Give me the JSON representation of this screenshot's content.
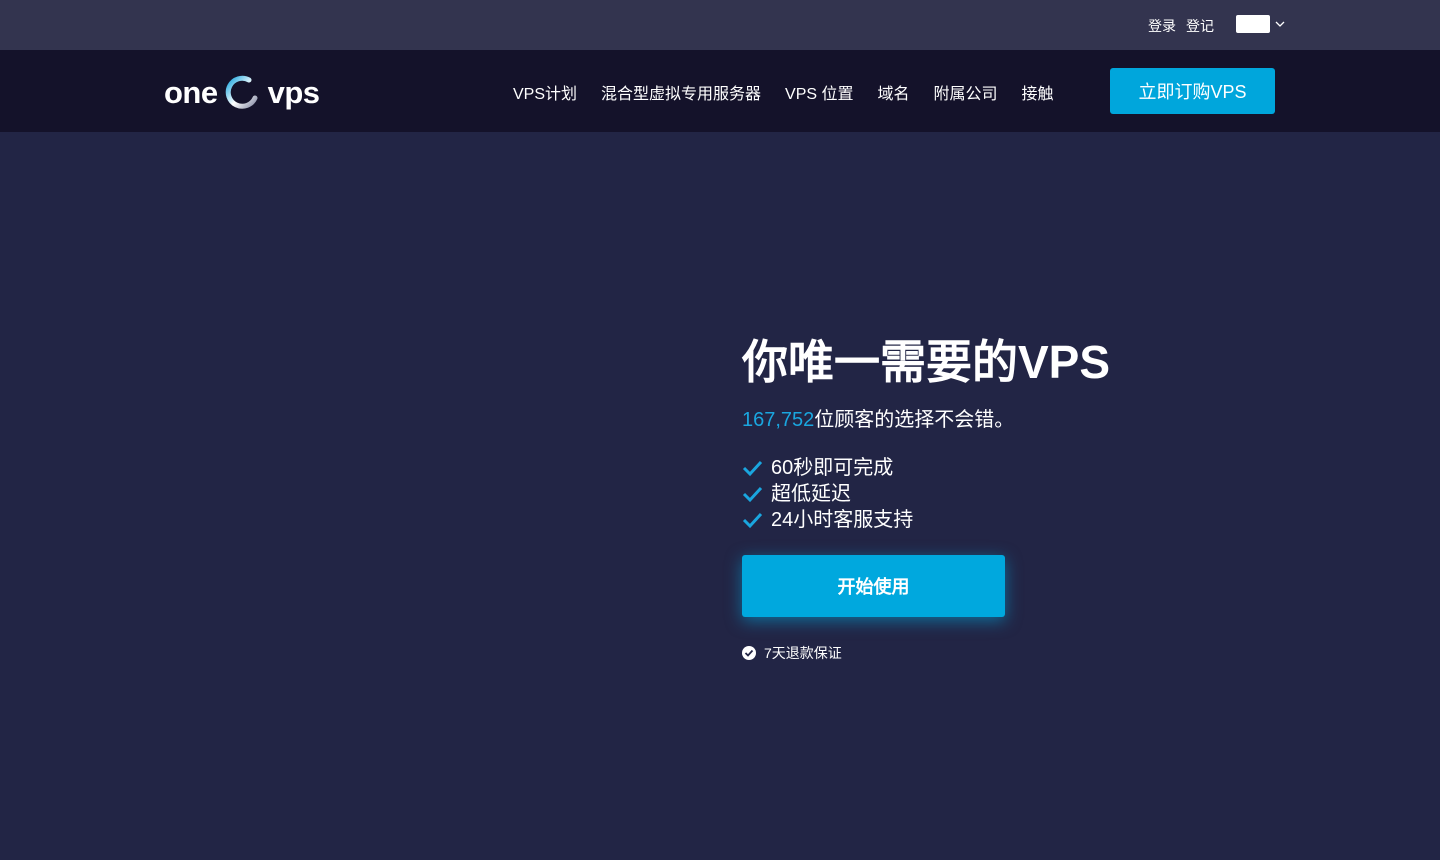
{
  "topbar": {
    "login": "登录",
    "register": "登记",
    "language_icon": "flag-icon"
  },
  "brand": {
    "left": "one",
    "right": "vps",
    "logo_icon": "ring-logo-icon"
  },
  "nav": {
    "items": [
      {
        "label": "VPS计划"
      },
      {
        "label": "混合型虚拟专用服务器"
      },
      {
        "label": "VPS 位置"
      },
      {
        "label": "域名"
      },
      {
        "label": "附属公司"
      },
      {
        "label": "接触"
      }
    ],
    "cta": "立即订购VPS"
  },
  "hero": {
    "title": "你唯一需要的VPS",
    "customer_count": "167,752",
    "subtitle_rest": "位顾客的选择不会错。",
    "features": [
      {
        "label": "60秒即可完成"
      },
      {
        "label": "超低延迟"
      },
      {
        "label": "24小时客服支持"
      }
    ],
    "start_button": "开始使用",
    "guarantee": "7天退款保证"
  },
  "colors": {
    "accent": "#00a6dc",
    "background": "#222545",
    "topbar": "#33344f",
    "navbar": "#14122a"
  }
}
